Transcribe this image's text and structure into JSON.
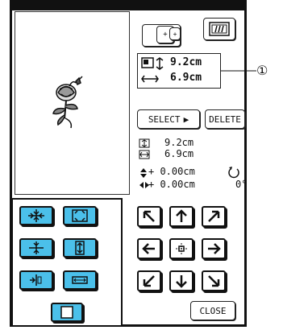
{
  "size_info": {
    "height": "9.2cm",
    "width": "6.9cm"
  },
  "callout": {
    "number": "①"
  },
  "buttons": {
    "select": "SELECT",
    "delete": "DELETE",
    "close": "CLOSE"
  },
  "details": {
    "height": "9.2cm",
    "width": "6.9cm",
    "vertical_offset": "+ 0.00cm",
    "horizontal_offset": "+ 0.00cm",
    "rotation": "0°"
  },
  "colors": {
    "accent": "#4bc0ea",
    "ink": "#111111"
  },
  "icons": {
    "layout_buttons": [
      "center-icon",
      "fit-icon",
      "compress-vertical-icon",
      "expand-vertical-icon",
      "compress-horizontal-icon",
      "expand-horizontal-icon"
    ],
    "direction_buttons": [
      "arrow-up-left-icon",
      "arrow-up-icon",
      "arrow-up-right-icon",
      "arrow-left-icon",
      "center-dot-icon",
      "arrow-right-icon",
      "arrow-down-left-icon",
      "arrow-down-icon",
      "arrow-down-right-icon"
    ]
  }
}
